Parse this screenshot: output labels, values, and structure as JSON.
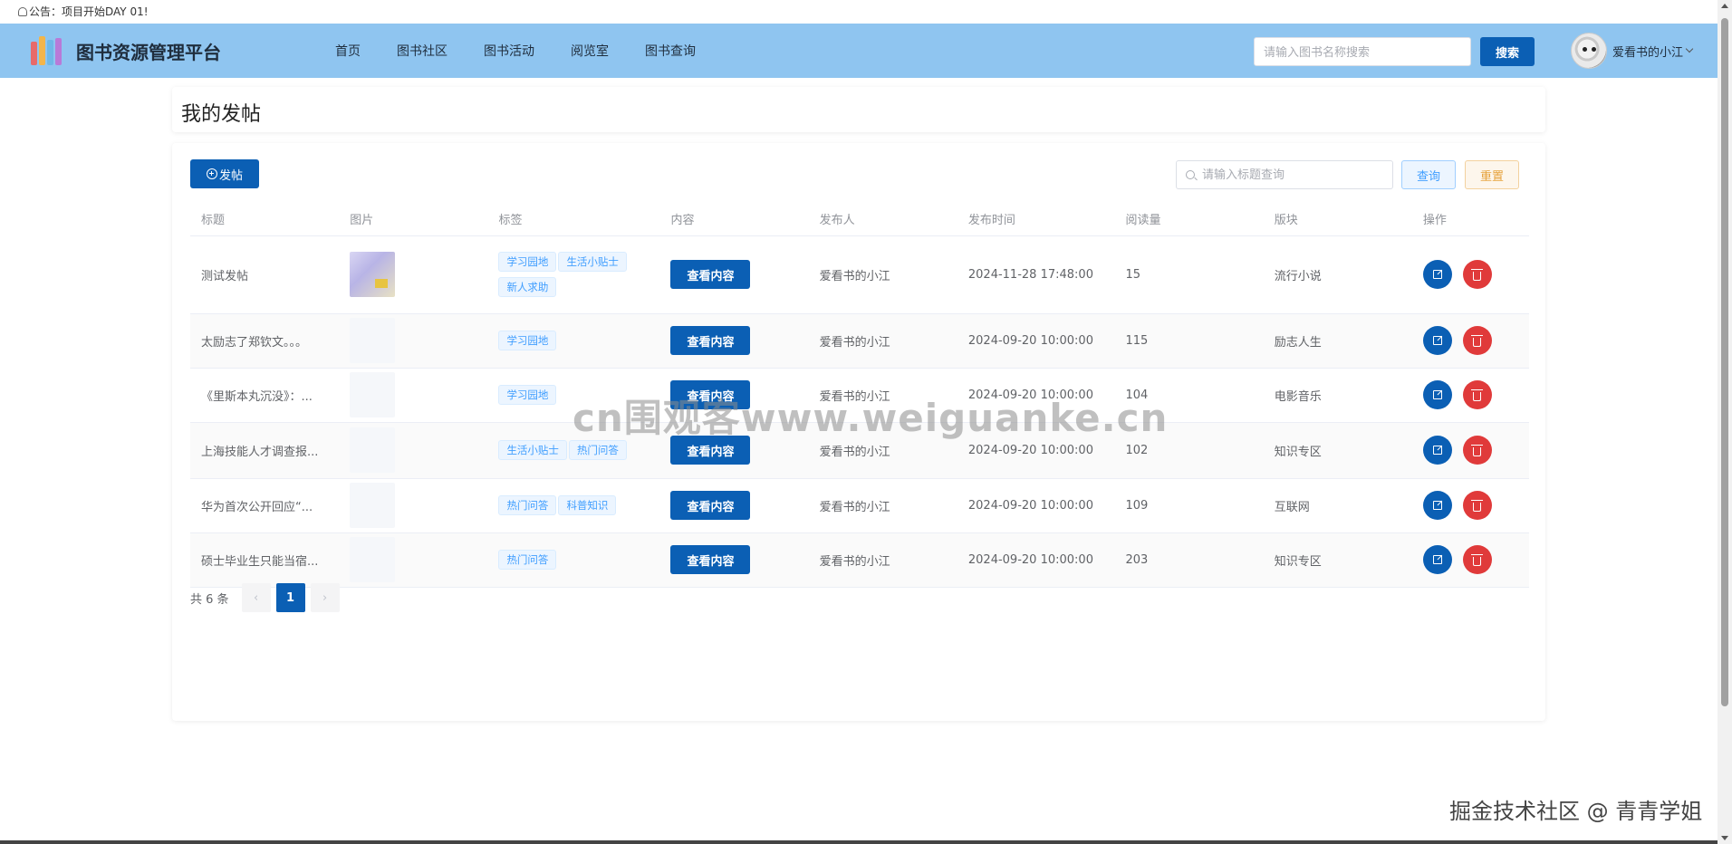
{
  "notice": {
    "text": "公告：项目开始DAY 01!"
  },
  "header": {
    "logo_title": "图书资源管理平台",
    "nav": [
      "首页",
      "图书社区",
      "图书活动",
      "阅览室",
      "图书查询"
    ],
    "search_placeholder": "请输入图书名称搜索",
    "search_button": "搜索",
    "username": "爱看书的小江"
  },
  "page": {
    "title": "我的发帖"
  },
  "toolbar": {
    "post_button": "发帖",
    "title_search_placeholder": "请输入标题查询",
    "query_button": "查询",
    "reset_button": "重置"
  },
  "table": {
    "columns": [
      "标题",
      "图片",
      "标签",
      "内容",
      "发布人",
      "发布时间",
      "阅读量",
      "版块",
      "操作"
    ],
    "view_button": "查看内容",
    "rows": [
      {
        "title": "测试发帖",
        "has_image": true,
        "tags": [
          "学习园地",
          "生活小贴士",
          "新人求助"
        ],
        "author": "爱看书的小江",
        "time": "2024-11-28 17:48:00",
        "reads": "15",
        "section": "流行小说"
      },
      {
        "title": "太励志了郑钦文。。。",
        "has_image": false,
        "tags": [
          "学习园地"
        ],
        "author": "爱看书的小江",
        "time": "2024-09-20 10:00:00",
        "reads": "115",
        "section": "励志人生"
      },
      {
        "title": "《里斯本丸沉没》：...",
        "has_image": false,
        "tags": [
          "学习园地"
        ],
        "author": "爱看书的小江",
        "time": "2024-09-20 10:00:00",
        "reads": "104",
        "section": "电影音乐"
      },
      {
        "title": "上海技能人才调查报...",
        "has_image": false,
        "tags": [
          "生活小贴士",
          "热门问答"
        ],
        "author": "爱看书的小江",
        "time": "2024-09-20 10:00:00",
        "reads": "102",
        "section": "知识专区"
      },
      {
        "title": "华为首次公开回应“...",
        "has_image": false,
        "tags": [
          "热门问答",
          "科普知识"
        ],
        "author": "爱看书的小江",
        "time": "2024-09-20 10:00:00",
        "reads": "109",
        "section": "互联网"
      },
      {
        "title": "硕士毕业生只能当宿...",
        "has_image": false,
        "tags": [
          "热门问答"
        ],
        "author": "爱看书的小江",
        "time": "2024-09-20 10:00:00",
        "reads": "203",
        "section": "知识专区"
      }
    ]
  },
  "pagination": {
    "total_text": "共 6 条",
    "prev": "‹",
    "current": "1",
    "next": "›"
  },
  "watermark": "cn围观客www.weiguanke.cn",
  "footer_mark": "掘金技术社区 @ 青青学姐",
  "colors": {
    "header_bg": "#8fc5f0",
    "primary": "#0b5fb4",
    "danger": "#e03a3a"
  },
  "icons": [
    "bell-icon",
    "books-logo-icon",
    "search-icon",
    "plus-circle-icon",
    "edit-icon",
    "delete-icon",
    "chevron-down-icon"
  ]
}
